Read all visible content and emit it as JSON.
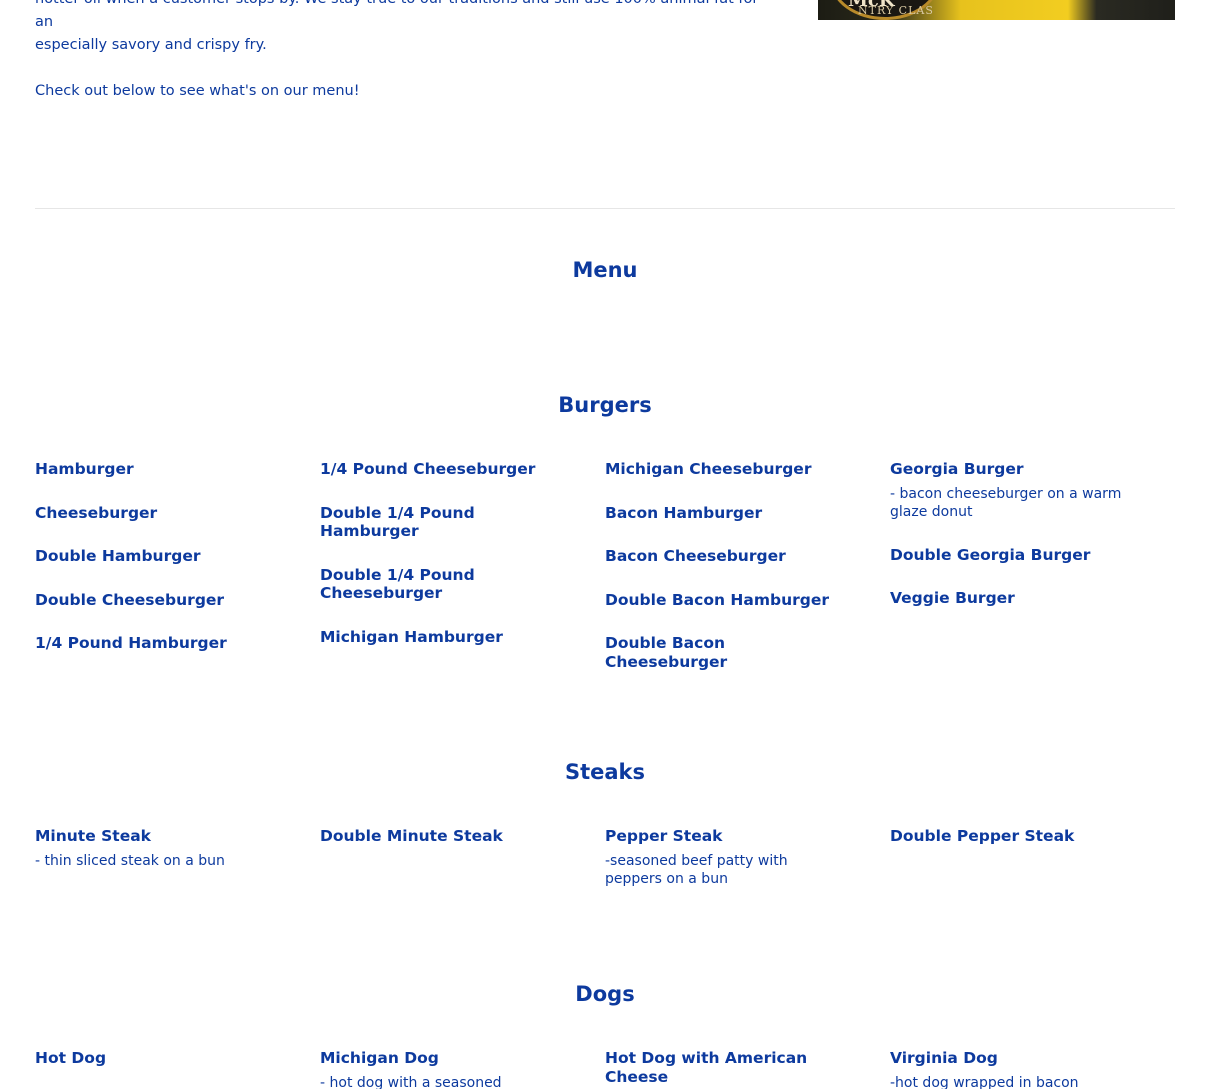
{
  "intro": {
    "line1": "hotter oil when a customer stops by. We stay true to our traditions and still use 100% animal fat for an",
    "line2": "especially savory and crispy fry.",
    "line3": "Check out below to see what's on our menu!"
  },
  "hero": {
    "badge_text": "McK",
    "badge_sub": "NTRY CLAS"
  },
  "menu": {
    "title": "Menu"
  },
  "burgers": {
    "title": "Burgers",
    "columns": [
      [
        {
          "name": "Hamburger"
        },
        {
          "name": "Cheeseburger"
        },
        {
          "name": "Double Hamburger"
        },
        {
          "name": "Double Cheeseburger"
        },
        {
          "name": "1/4 Pound Hamburger"
        }
      ],
      [
        {
          "name": "1/4 Pound Cheeseburger"
        },
        {
          "name": "Double 1/4 Pound Hamburger"
        },
        {
          "name": "Double 1/4 Pound Cheeseburger"
        },
        {
          "name": "Michigan Hamburger"
        }
      ],
      [
        {
          "name": "Michigan Cheeseburger"
        },
        {
          "name": "Bacon Hamburger"
        },
        {
          "name": "Bacon Cheeseburger"
        },
        {
          "name": "Double Bacon Hamburger"
        },
        {
          "name": "Double Bacon Cheeseburger"
        }
      ],
      [
        {
          "name": "Georgia Burger",
          "desc": "- bacon cheeseburger on a warm glaze donut"
        },
        {
          "name": "Double Georgia Burger"
        },
        {
          "name": "Veggie Burger"
        }
      ]
    ]
  },
  "steaks": {
    "title": "Steaks",
    "columns": [
      [
        {
          "name": "Minute Steak",
          "desc": "- thin sliced steak on a bun"
        }
      ],
      [
        {
          "name": "Double Minute Steak"
        }
      ],
      [
        {
          "name": "Pepper Steak",
          "desc": "-seasoned beef patty with peppers on a bun"
        }
      ],
      [
        {
          "name": "Double Pepper Steak"
        }
      ]
    ]
  },
  "dogs": {
    "title": "Dogs",
    "columns": [
      [
        {
          "name": "Hot Dog"
        }
      ],
      [
        {
          "name": "Michigan Dog",
          "desc": "- hot dog with a seasoned"
        }
      ],
      [
        {
          "name": "Hot Dog with American Cheese"
        }
      ],
      [
        {
          "name": "Virginia Dog",
          "desc": "-hot dog wrapped in bacon"
        }
      ]
    ]
  }
}
